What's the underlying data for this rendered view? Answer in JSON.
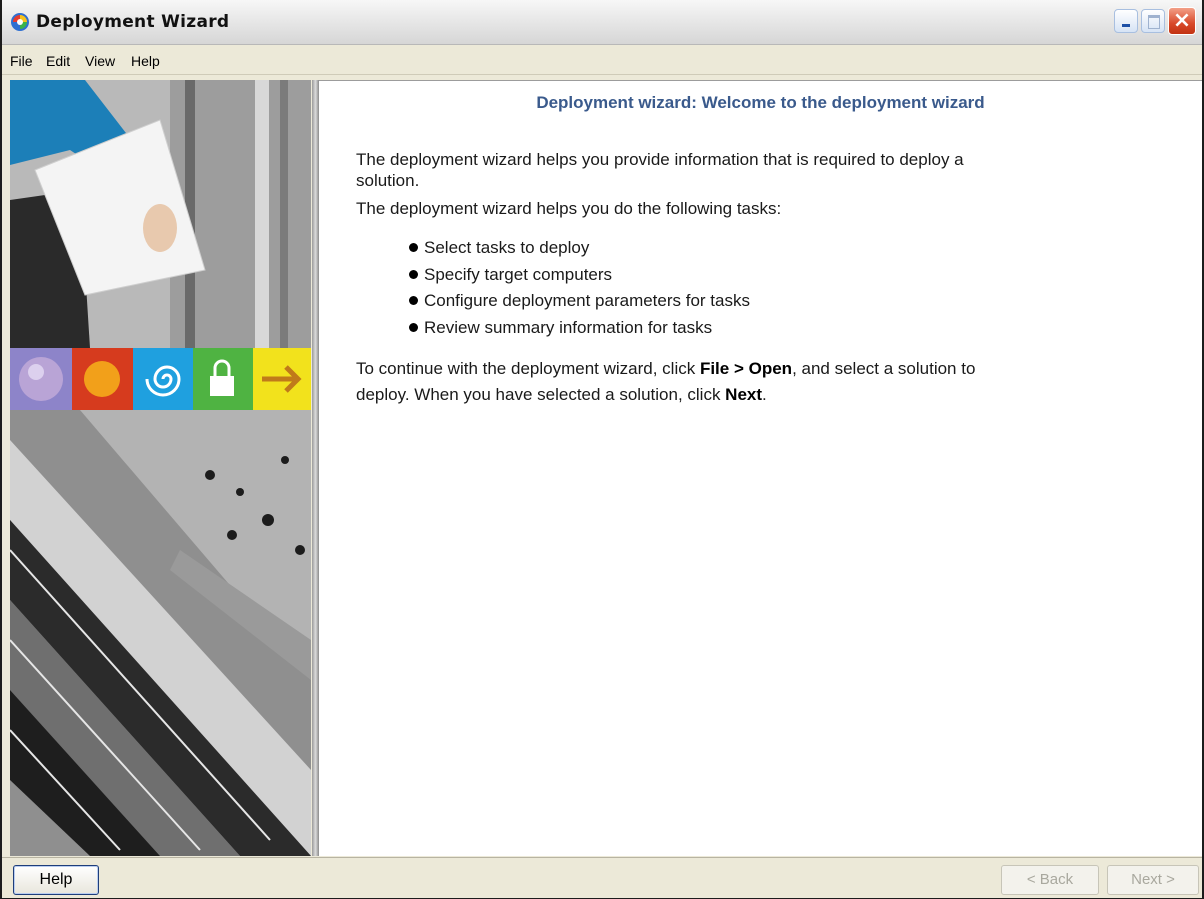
{
  "window": {
    "title": "Deployment Wizard"
  },
  "menu": {
    "items": [
      "File",
      "Edit",
      "View",
      "Help"
    ]
  },
  "content": {
    "heading": "Deployment wizard: Welcome to the deployment wizard",
    "intro_line1": "The deployment wizard helps you provide information that is required to deploy a",
    "intro_line2": "solution.",
    "intro_line3": "The deployment wizard helps you do the following tasks:",
    "tasks": [
      "Select tasks to deploy",
      "Specify target computers",
      "Configure deployment parameters for tasks",
      "Review summary information for tasks"
    ],
    "continue_prefix": "To continue with the deployment wizard, click ",
    "continue_bold1": "File > Open",
    "continue_mid": ", and select a solution to",
    "continue_line2_prefix": "deploy. When you have selected a solution, click ",
    "continue_bold2": "Next",
    "continue_suffix": "."
  },
  "buttons": {
    "help": "Help",
    "back": "< Back",
    "next": "Next >"
  },
  "colors": {
    "heading": "#3a5a8c",
    "window_bg": "#ece9d8",
    "close_button": "#d8492a"
  },
  "icons": {
    "app": "deployment-wizard-icon",
    "banner_strip": [
      "sphere-icon",
      "network-icon",
      "spiral-icon",
      "lock-icon",
      "arrow-right-icon"
    ]
  }
}
